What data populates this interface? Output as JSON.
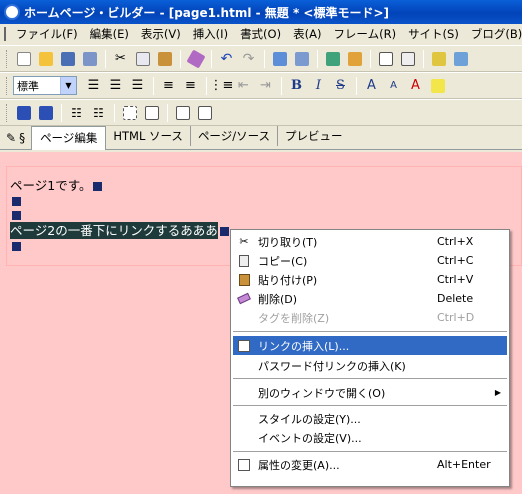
{
  "window": {
    "title": "ホームページ・ビルダー - [page1.html - 無題 * <標準モード>]"
  },
  "menubar": {
    "items": [
      "ファイル(F)",
      "編集(E)",
      "表示(V)",
      "挿入(I)",
      "書式(O)",
      "表(A)",
      "フレーム(R)",
      "サイト(S)",
      "ブログ(B)"
    ]
  },
  "style_select": {
    "value": "標準"
  },
  "tabs": [
    {
      "label": "ページ編集",
      "active": true
    },
    {
      "label": "HTML ソース",
      "active": false
    },
    {
      "label": "ページ/ソース",
      "active": false
    },
    {
      "label": "プレビュー",
      "active": false
    }
  ],
  "editor": {
    "line1": "ページ1です。",
    "selected": "ページ2の一番下にリンクするあああ"
  },
  "context_menu": [
    {
      "label": "切り取り(T)",
      "shortcut": "Ctrl+X",
      "icon": "scissors-icon"
    },
    {
      "label": "コピー(C)",
      "shortcut": "Ctrl+C",
      "icon": "copy-icon"
    },
    {
      "label": "貼り付け(P)",
      "shortcut": "Ctrl+V",
      "icon": "paste-icon"
    },
    {
      "label": "削除(D)",
      "shortcut": "Delete",
      "icon": "eraser-icon"
    },
    {
      "label": "タグを削除(Z)",
      "shortcut": "Ctrl+D",
      "disabled": true
    },
    {
      "label": "リンクの挿入(L)...",
      "highlighted": true,
      "icon": "link-insert-icon"
    },
    {
      "label": "パスワード付リンクの挿入(K)"
    },
    {
      "label": "別のウィンドウで開く(O)",
      "submenu": true
    },
    {
      "label": "スタイルの設定(Y)..."
    },
    {
      "label": "イベントの設定(V)..."
    },
    {
      "label": "属性の変更(A)...",
      "shortcut": "Alt+Enter",
      "icon": "attributes-icon"
    }
  ],
  "colors": {
    "editor_bg": "#ffc9c9",
    "selection": "#1e3a3a",
    "highlight": "#316ac5"
  }
}
